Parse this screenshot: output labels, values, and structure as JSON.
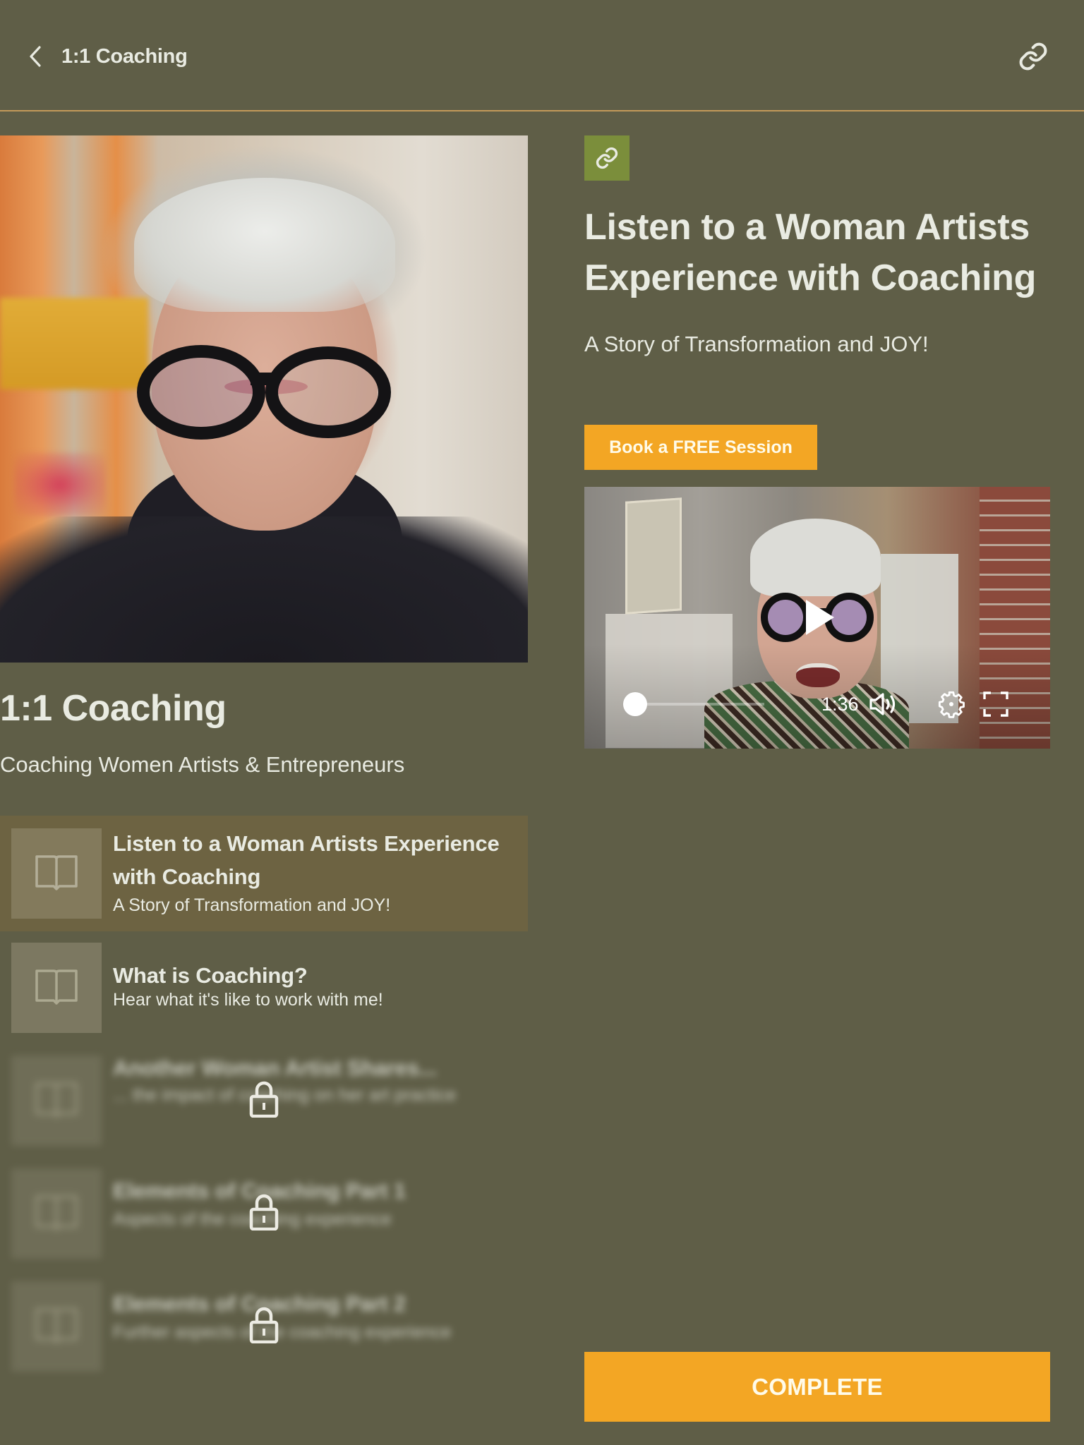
{
  "header": {
    "back_icon": "chevron-left-icon",
    "title": "1:1 Coaching",
    "link_icon": "link-icon"
  },
  "colors": {
    "background": "#5f5e47",
    "accent": "#f3a624",
    "divider": "#c39a5a",
    "active_item": "#6d6342",
    "type_badge": "#7b8e3b",
    "text": "#e9ebe2"
  },
  "course": {
    "title": "1:1 Coaching",
    "subtitle": "Coaching Women Artists & Entrepreneurs"
  },
  "lessons": [
    {
      "title": "Listen to a Woman Artists Experience with Coaching",
      "subtitle": "A Story of Transformation and JOY!",
      "icon": "book-open-icon",
      "active": true,
      "locked": false
    },
    {
      "title": "What is Coaching?",
      "subtitle": "Hear what it's like to work with me!",
      "icon": "book-open-icon",
      "active": false,
      "locked": false
    },
    {
      "title": "Another Woman Artist Shares...",
      "subtitle": "... the impact of coaching on her art practice",
      "icon": "book-open-icon",
      "active": false,
      "locked": true
    },
    {
      "title": "Elements of Coaching Part 1",
      "subtitle": "Aspects of the coaching experience",
      "icon": "book-open-icon",
      "active": false,
      "locked": true
    },
    {
      "title": "Elements of Coaching Part 2",
      "subtitle": "Further aspects of the coaching experience",
      "icon": "book-open-icon",
      "active": false,
      "locked": true
    }
  ],
  "detail": {
    "type_icon": "link-icon",
    "title": "Listen to a Woman Artists Experience with Coaching",
    "subtitle": "A Story of Transformation and JOY!",
    "cta_label": "Book a FREE Session",
    "video": {
      "duration": "1:36",
      "progress": 0.0,
      "icons": [
        "play-icon",
        "volume-icon",
        "settings-gear-icon",
        "fullscreen-icon"
      ]
    },
    "complete_label": "COMPLETE"
  }
}
